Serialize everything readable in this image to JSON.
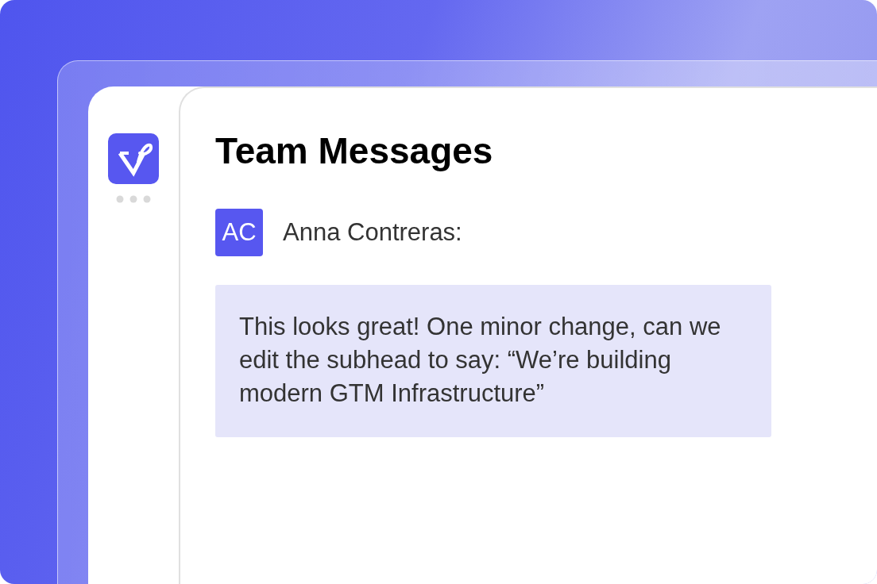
{
  "title": "Team Messages",
  "messages": [
    {
      "initials": "AC",
      "sender": "Anna Contreras:",
      "text": "This looks great! One minor change, can we edit the subhead to say: “We’re building modern GTM Infrastructure”"
    }
  ]
}
